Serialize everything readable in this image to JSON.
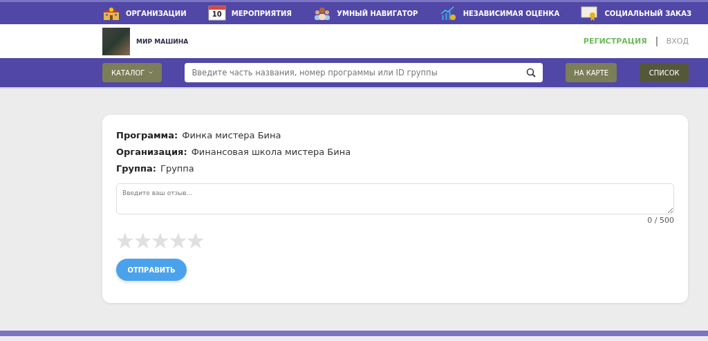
{
  "top_nav": [
    {
      "kind": "building",
      "label": "ОРГАНИЗАЦИИ"
    },
    {
      "kind": "calendar",
      "label": "МЕРОПРИЯТИЯ",
      "icon_text": "10"
    },
    {
      "kind": "people",
      "label": "УМНЫЙ НАВИГАТОР"
    },
    {
      "kind": "chart",
      "label": "НЕЗАВИСИМАЯ ОЦЕНКА"
    },
    {
      "kind": "certificate",
      "label": "СОЦИАЛЬНЫЙ ЗАКАЗ"
    }
  ],
  "header": {
    "site_name": "МИР МАШИНА",
    "register": "РЕГИСТРАЦИЯ",
    "login": "ВХОД"
  },
  "search_bar": {
    "catalog": "КАТАЛОГ",
    "placeholder": "Введите часть названия, номер программы или ID группы",
    "map_button": "НА КАРТЕ",
    "list_button": "СПИСОК"
  },
  "review": {
    "fields": [
      {
        "label": "Программа:",
        "value": "Финка мистера Бина"
      },
      {
        "label": "Организация:",
        "value": "Финансовая школа мистера Бина"
      },
      {
        "label": "Группа:",
        "value": "Группа"
      }
    ],
    "placeholder": "Введите ваш отзыв...",
    "counter": "0 / 500",
    "stars": 0,
    "submit": "ОТПРАВИТЬ"
  }
}
